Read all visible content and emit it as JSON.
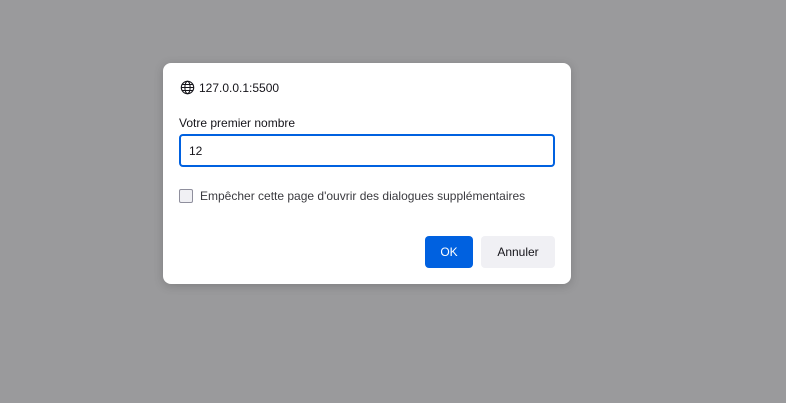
{
  "dialog": {
    "origin": "127.0.0.1:5500",
    "origin_icon": "globe-icon",
    "prompt_label": "Votre premier nombre",
    "input_value": "12",
    "checkbox_label": "Empêcher cette page d'ouvrir des dialogues supplémentaires",
    "checkbox_checked": false,
    "ok_label": "OK",
    "cancel_label": "Annuler"
  },
  "colors": {
    "backdrop": "#9a9a9c",
    "accent": "#0061e0",
    "cancel_bg": "#f0f0f4",
    "text": "#15141a"
  }
}
